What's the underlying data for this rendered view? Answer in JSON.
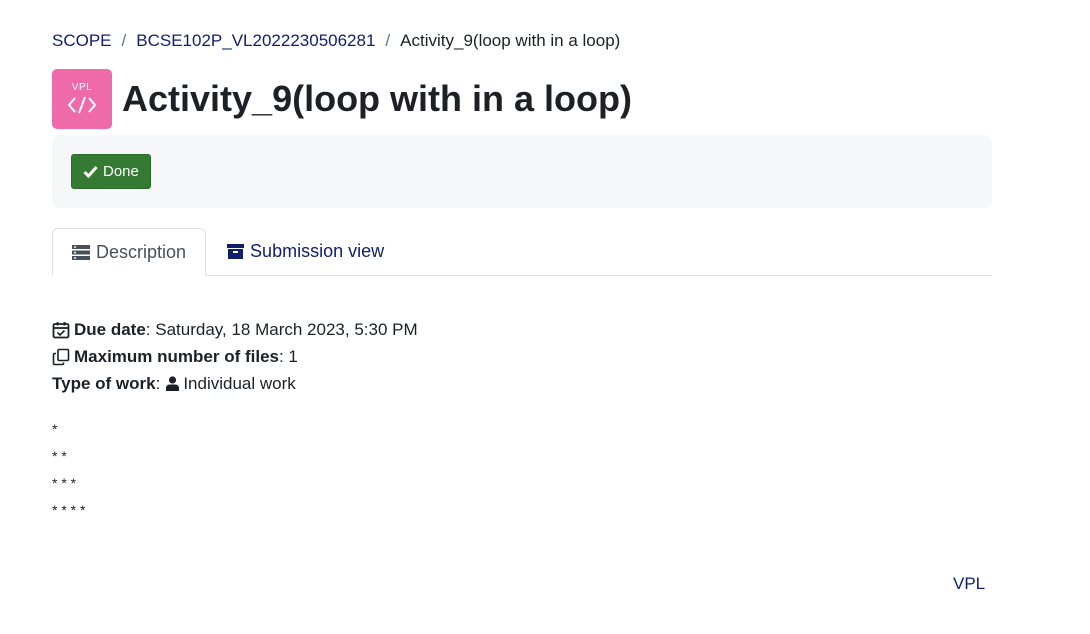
{
  "breadcrumb": {
    "items": [
      "SCOPE",
      "BCSE102P_VL2022230506281"
    ],
    "separator": "/",
    "current": "Activity_9(loop with in a loop)"
  },
  "header": {
    "icon_label": "VPL",
    "icon_color": "#ee6aa9",
    "title": "Activity_9(loop with in a loop)"
  },
  "completion": {
    "done_label": "Done",
    "done_color": "#357a32"
  },
  "tabs": [
    {
      "label": "Description",
      "icon": "list-icon",
      "active": true
    },
    {
      "label": "Submission view",
      "icon": "archive-icon",
      "active": false
    }
  ],
  "details": {
    "due_label": "Due date",
    "due_value": ": Saturday, 18 March 2023, 5:30 PM",
    "max_files_label": "Maximum number of files",
    "max_files_value": ": 1",
    "type_label": "Type of work",
    "type_colon": ":",
    "type_value": "Individual work"
  },
  "description_lines": [
    "*",
    "* *",
    "* * *",
    "* * * *"
  ],
  "footer": {
    "link": "VPL"
  }
}
